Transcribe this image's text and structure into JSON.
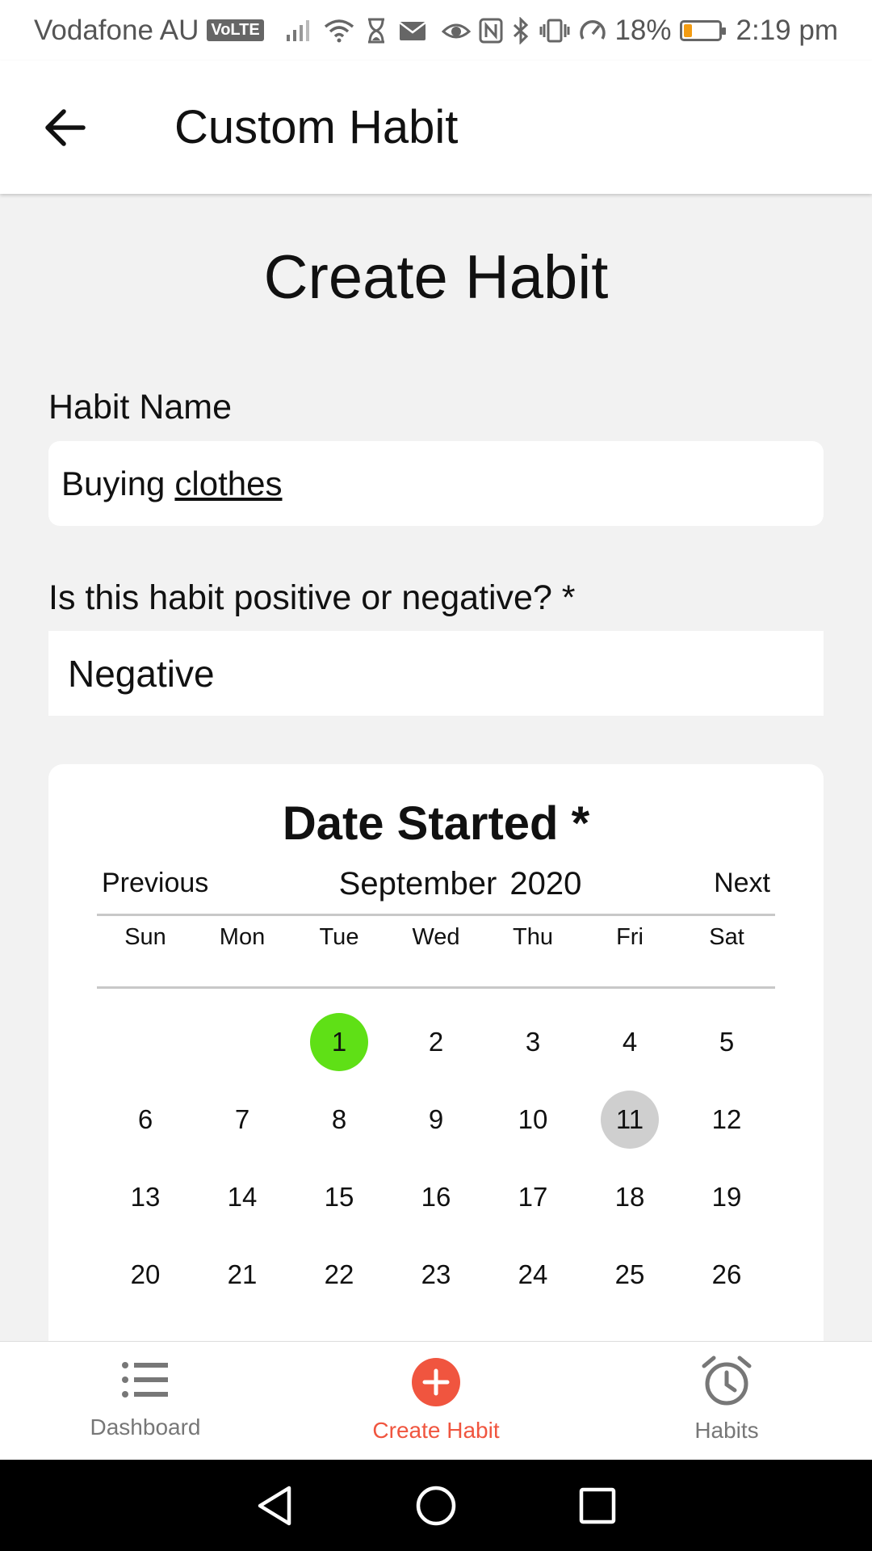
{
  "status_bar": {
    "carrier": "Vodafone AU",
    "volte": "VoLTE",
    "battery_percent": "18%",
    "battery_level": 0.18,
    "time": "2:19 pm",
    "icons": [
      "signal-icon",
      "wifi-icon",
      "hourglass-icon",
      "mail-icon",
      "eye-icon",
      "nfc-icon",
      "bluetooth-icon",
      "vibrate-icon",
      "speed-icon",
      "battery-icon"
    ]
  },
  "app_bar": {
    "back_icon": "arrow-left-icon",
    "title": "Custom Habit"
  },
  "form": {
    "heading": "Create Habit",
    "habit_name_label": "Habit Name",
    "habit_name_value_word1": "Buying",
    "habit_name_value_word2": "clothes",
    "polarity_label": "Is this habit positive or negative? *",
    "polarity_value": "Negative"
  },
  "calendar": {
    "title": "Date Started *",
    "prev_label": "Previous",
    "next_label": "Next",
    "month": "September",
    "year": "2020",
    "weekdays": [
      "Sun",
      "Mon",
      "Tue",
      "Wed",
      "Thu",
      "Fri",
      "Sat"
    ],
    "days": [
      "",
      "",
      "1",
      "2",
      "3",
      "4",
      "5",
      "6",
      "7",
      "8",
      "9",
      "10",
      "11",
      "12",
      "13",
      "14",
      "15",
      "16",
      "17",
      "18",
      "19",
      "20",
      "21",
      "22",
      "23",
      "24",
      "25",
      "26"
    ],
    "selected_day": "1",
    "today_day": "11",
    "selected_color": "#5fe016",
    "today_color": "#cfcfcf"
  },
  "bottom_nav": {
    "items": [
      {
        "label": "Dashboard",
        "icon": "list-icon"
      },
      {
        "label": "Create Habit",
        "icon": "add-circle-icon"
      },
      {
        "label": "Habits",
        "icon": "alarm-clock-icon"
      }
    ],
    "active_color": "#f0553f"
  },
  "system_nav": {
    "icons": [
      "back-triangle-icon",
      "home-circle-icon",
      "recents-square-icon"
    ]
  }
}
